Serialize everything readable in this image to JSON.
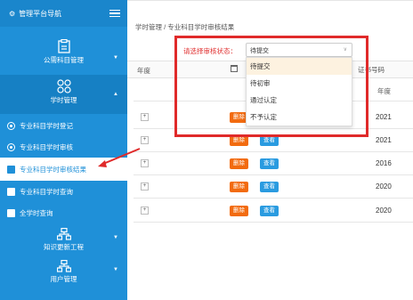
{
  "sidebar": {
    "title": "管理平台导航",
    "sections": [
      {
        "label": "公需科目管理"
      },
      {
        "label": "学时管理"
      }
    ],
    "subitems": [
      {
        "label": "专业科目学时登记"
      },
      {
        "label": "专业科目学时审核"
      },
      {
        "label": "专业科目学时审核结果"
      },
      {
        "label": "专业科目学时查询"
      },
      {
        "label": "全学时查询"
      }
    ],
    "bottom": [
      {
        "label": "知识更新工程"
      },
      {
        "label": "用户管理"
      }
    ]
  },
  "main": {
    "breadcrumb": "学时管理 / 专业科目学时审核结果",
    "filter": {
      "year_label": "年度",
      "cert_label": "证书号码"
    },
    "status_filter": {
      "label": "请选择审核状态：",
      "value": "待提交",
      "options": [
        "待提交",
        "待初审",
        "通过认定",
        "不予认定"
      ]
    },
    "table": {
      "header_year": "年度",
      "rows": [
        {
          "expand": "+",
          "delete": "删除",
          "view": "查看",
          "year": "2021"
        },
        {
          "expand": "+",
          "delete": "删除",
          "view": "查看",
          "year": "2021"
        },
        {
          "expand": "+",
          "delete": "删除",
          "view": "查看",
          "year": "2016"
        },
        {
          "expand": "+",
          "delete": "删除",
          "view": "查看",
          "year": "2020"
        },
        {
          "expand": "+",
          "delete": "删除",
          "view": "查看",
          "year": "2020"
        }
      ]
    }
  },
  "colors": {
    "sidebar": "#1f90d8",
    "delete_button": "#f26b0f",
    "view_button": "#2a9be0",
    "highlight_box": "#e02a2a",
    "status_label": "#e03030"
  }
}
